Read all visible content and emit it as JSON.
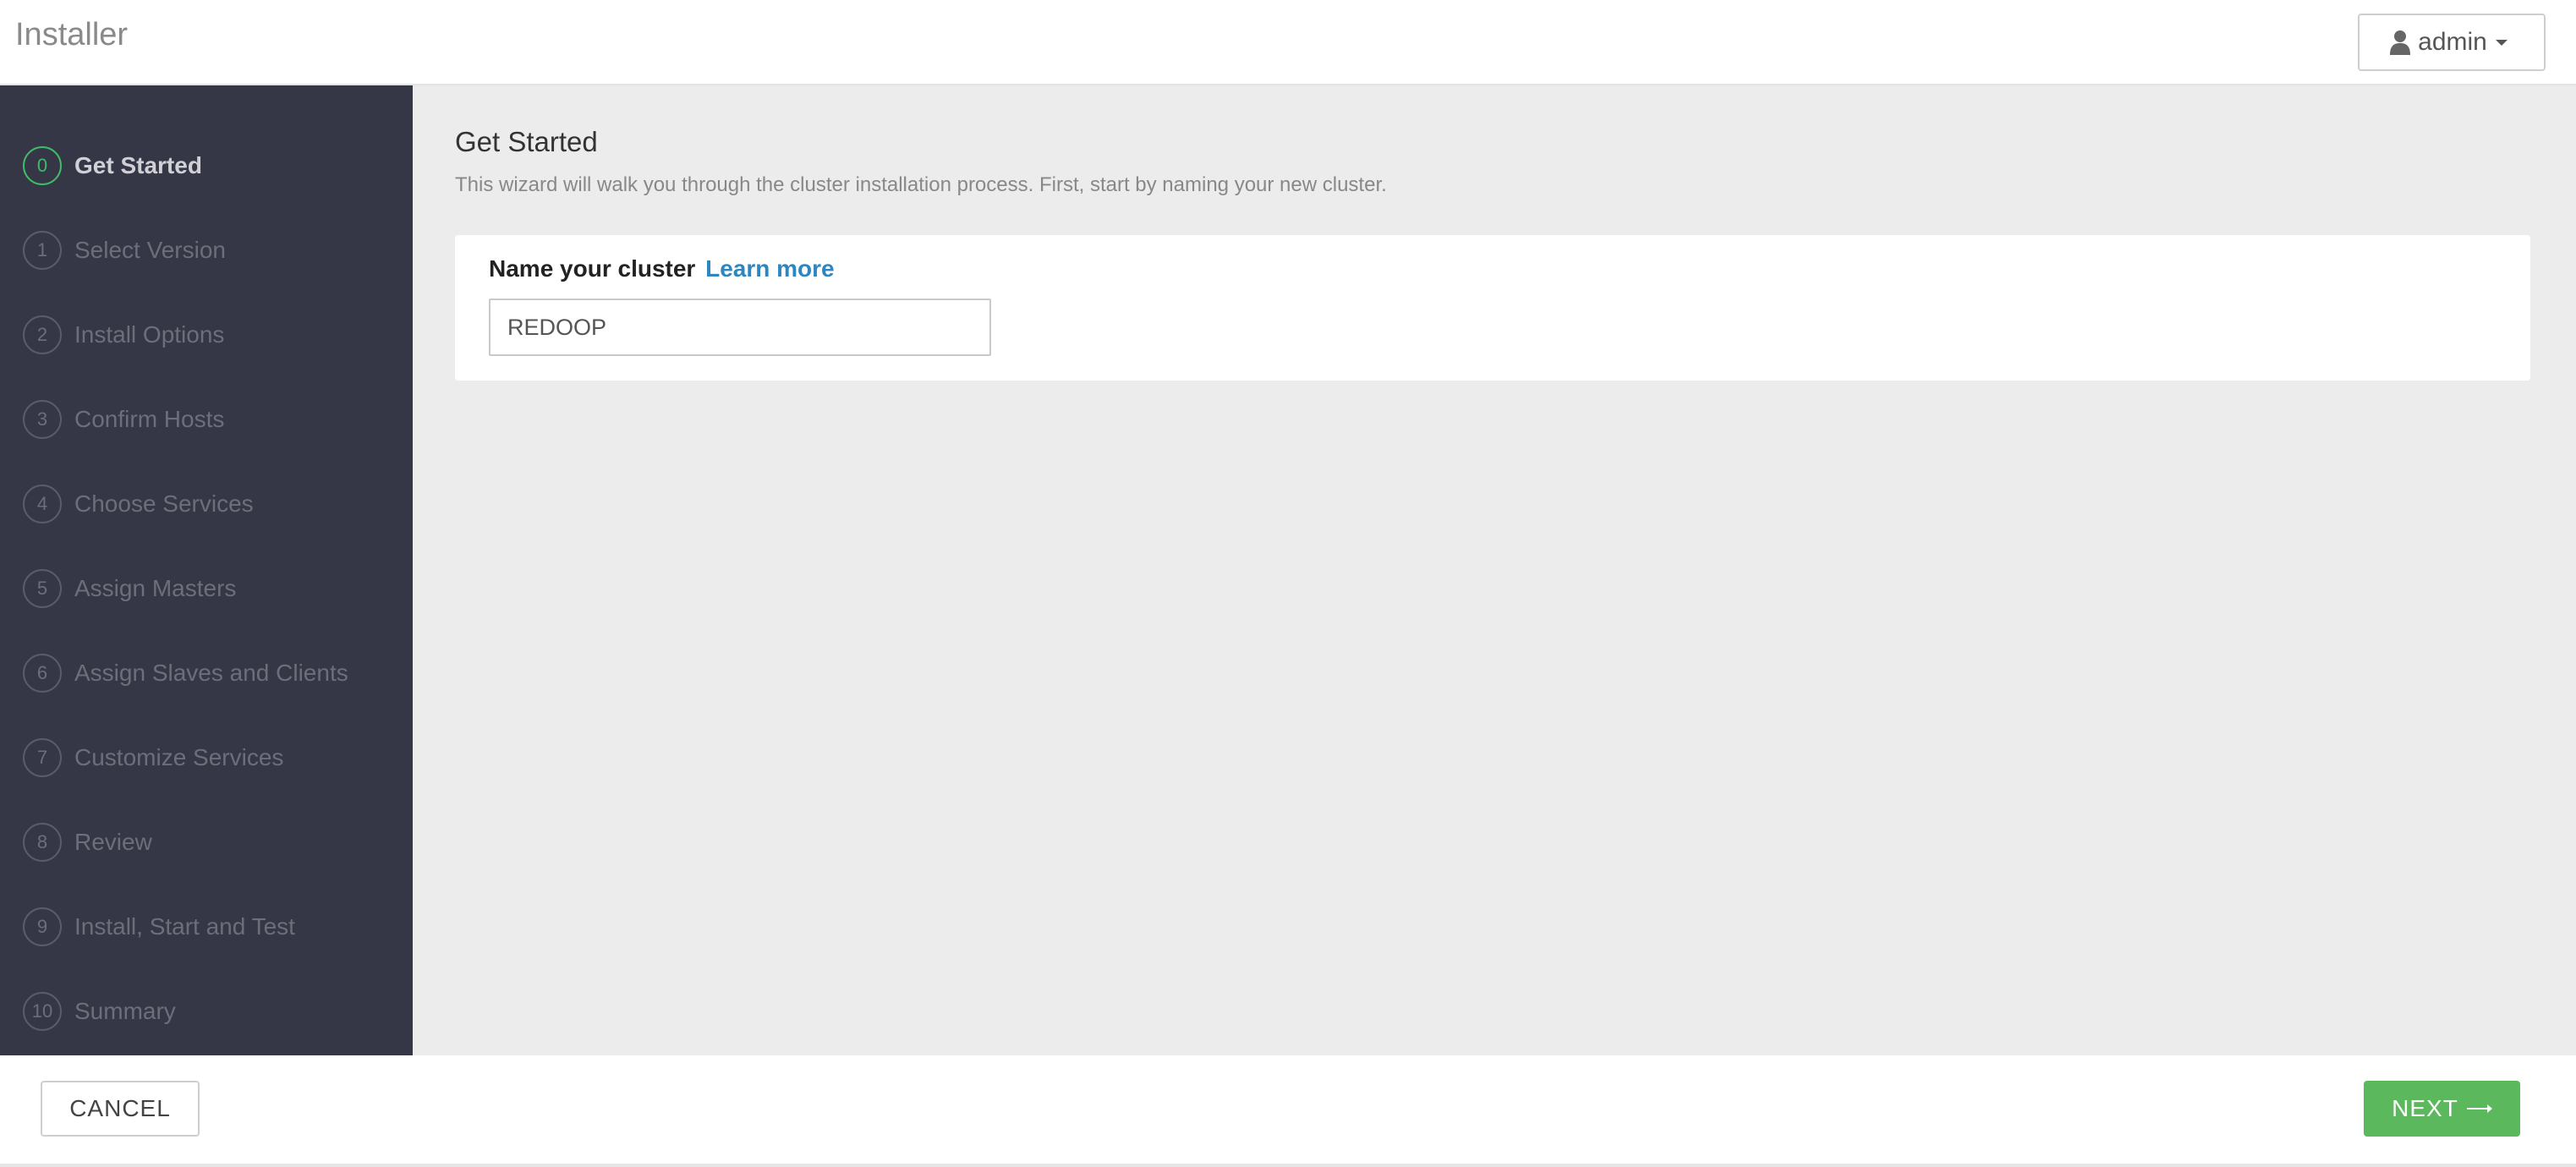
{
  "header": {
    "app_title": "Installer",
    "user_label": "admin",
    "user_icon": "user-icon",
    "caret_icon": "caret-down-icon"
  },
  "sidebar": {
    "steps": [
      {
        "num": "0",
        "label": "Get Started",
        "active": true
      },
      {
        "num": "1",
        "label": "Select Version",
        "active": false
      },
      {
        "num": "2",
        "label": "Install Options",
        "active": false
      },
      {
        "num": "3",
        "label": "Confirm Hosts",
        "active": false
      },
      {
        "num": "4",
        "label": "Choose Services",
        "active": false
      },
      {
        "num": "5",
        "label": "Assign Masters",
        "active": false
      },
      {
        "num": "6",
        "label": "Assign Slaves and Clients",
        "active": false
      },
      {
        "num": "7",
        "label": "Customize Services",
        "active": false
      },
      {
        "num": "8",
        "label": "Review",
        "active": false
      },
      {
        "num": "9",
        "label": "Install, Start and Test",
        "active": false
      },
      {
        "num": "10",
        "label": "Summary",
        "active": false
      }
    ]
  },
  "main": {
    "title": "Get Started",
    "description": "This wizard will walk you through the cluster installation process. First, start by naming your new cluster.",
    "card": {
      "label": "Name your cluster",
      "learn_more": "Learn more",
      "input_value": "REDOOP"
    }
  },
  "footer": {
    "cancel_label": "CANCEL",
    "next_label": "NEXT",
    "next_icon": "arrow-right-icon"
  },
  "colors": {
    "sidebar_bg": "#353746",
    "active_step": "#3fbc6a",
    "link": "#2e86c1",
    "next_button": "#5cb85c",
    "main_bg": "#ececec"
  }
}
